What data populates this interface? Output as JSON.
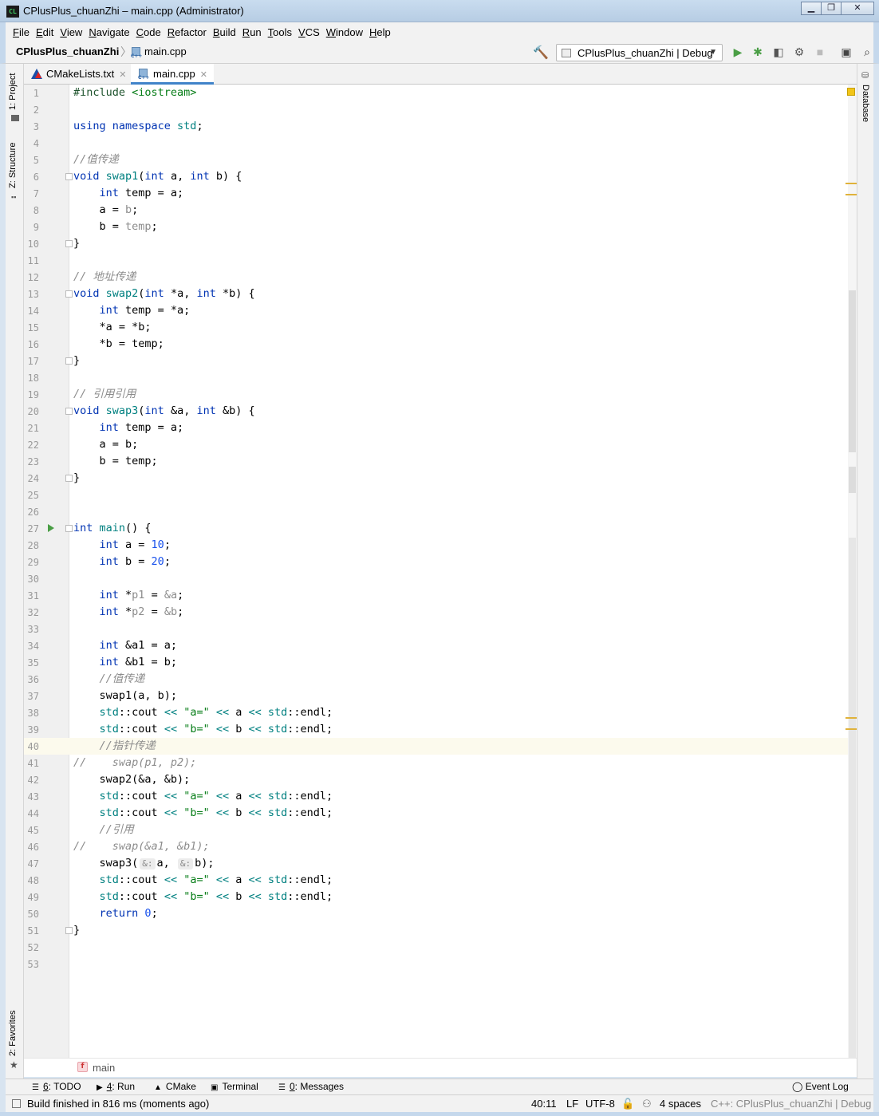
{
  "window": {
    "title": "CPlusPlus_chuanZhi – main.cpp (Administrator)",
    "app_icon_text": "CL",
    "buttons": [
      "▁",
      "❐",
      "✕"
    ]
  },
  "menu": [
    {
      "mnemonic": "F",
      "rest": "ile"
    },
    {
      "mnemonic": "E",
      "rest": "dit"
    },
    {
      "mnemonic": "V",
      "rest": "iew"
    },
    {
      "mnemonic": "N",
      "rest": "avigate"
    },
    {
      "mnemonic": "C",
      "rest": "ode"
    },
    {
      "mnemonic": "R",
      "rest": "efactor"
    },
    {
      "mnemonic": "B",
      "rest": "uild"
    },
    {
      "mnemonic": "R",
      "rest": "un"
    },
    {
      "mnemonic": "T",
      "rest": "ools"
    },
    {
      "mnemonic": "V",
      "rest": "CS"
    },
    {
      "mnemonic": "W",
      "rest": "indow"
    },
    {
      "mnemonic": "H",
      "rest": "elp"
    }
  ],
  "nav": {
    "project": "CPlusPlus_chuanZhi",
    "file": "main.cpp",
    "run_config": "CPlusPlus_chuanZhi | Debug"
  },
  "side_tabs": {
    "project": "1: Project",
    "structure": "Z: Structure",
    "favorites": "2: Favorites",
    "database": "Database"
  },
  "tabs": [
    {
      "label": "CMakeLists.txt",
      "active": false
    },
    {
      "label": "main.cpp",
      "active": true
    }
  ],
  "editor": {
    "current_line": 40,
    "lines": [
      [
        [
          "pp",
          "#include "
        ],
        [
          "inc",
          "<iostream>"
        ]
      ],
      [],
      [
        [
          "kw",
          "using namespace "
        ],
        [
          "ns",
          "std"
        ],
        [
          "",
          "; "
        ]
      ],
      [],
      [
        [
          "cm",
          "//值传递"
        ]
      ],
      [
        [
          "kw",
          "void "
        ],
        [
          "ns",
          "swap1"
        ],
        [
          "",
          "("
        ],
        [
          "kw",
          "int "
        ],
        [
          "",
          "a, "
        ],
        [
          "kw",
          "int "
        ],
        [
          "",
          "b) {"
        ]
      ],
      [
        [
          "",
          "    "
        ],
        [
          "kw",
          "int "
        ],
        [
          "",
          "temp = a;"
        ]
      ],
      [
        [
          "",
          "    a = "
        ],
        [
          "gray",
          "b"
        ],
        [
          "",
          ";"
        ]
      ],
      [
        [
          "",
          "    b = "
        ],
        [
          "gray",
          "temp"
        ],
        [
          "",
          ";"
        ]
      ],
      [
        [
          "",
          "}"
        ]
      ],
      [],
      [
        [
          "cm",
          "// 地址传递"
        ]
      ],
      [
        [
          "kw",
          "void "
        ],
        [
          "ns",
          "swap2"
        ],
        [
          "",
          "("
        ],
        [
          "kw",
          "int "
        ],
        [
          "",
          "*a, "
        ],
        [
          "kw",
          "int "
        ],
        [
          "",
          "*b) {"
        ]
      ],
      [
        [
          "",
          "    "
        ],
        [
          "kw",
          "int "
        ],
        [
          "",
          "temp = *a;"
        ]
      ],
      [
        [
          "",
          "    *a = *b;"
        ]
      ],
      [
        [
          "",
          "    *b = temp;"
        ]
      ],
      [
        [
          "",
          "}"
        ]
      ],
      [],
      [
        [
          "cm",
          "// 引用引用"
        ]
      ],
      [
        [
          "kw",
          "void "
        ],
        [
          "ns",
          "swap3"
        ],
        [
          "",
          "("
        ],
        [
          "kw",
          "int "
        ],
        [
          "",
          "&a, "
        ],
        [
          "kw",
          "int "
        ],
        [
          "",
          "&b) {"
        ]
      ],
      [
        [
          "",
          "    "
        ],
        [
          "kw",
          "int "
        ],
        [
          "",
          "temp = a;"
        ]
      ],
      [
        [
          "",
          "    a = b;"
        ]
      ],
      [
        [
          "",
          "    b = temp;"
        ]
      ],
      [
        [
          "",
          "}"
        ]
      ],
      [],
      [],
      [
        [
          "kw",
          "int "
        ],
        [
          "ns",
          "main"
        ],
        [
          "",
          "() {"
        ]
      ],
      [
        [
          "",
          "    "
        ],
        [
          "kw",
          "int "
        ],
        [
          "",
          "a = "
        ],
        [
          "num",
          "10"
        ],
        [
          "",
          ";"
        ]
      ],
      [
        [
          "",
          "    "
        ],
        [
          "kw",
          "int "
        ],
        [
          "",
          "b = "
        ],
        [
          "num",
          "20"
        ],
        [
          "",
          ";"
        ]
      ],
      [],
      [
        [
          "",
          "    "
        ],
        [
          "kw",
          "int "
        ],
        [
          "",
          "*"
        ],
        [
          "gray",
          "p1"
        ],
        [
          "",
          " = "
        ],
        [
          "gray",
          "&a"
        ],
        [
          "",
          ";"
        ]
      ],
      [
        [
          "",
          "    "
        ],
        [
          "kw",
          "int "
        ],
        [
          "",
          "*"
        ],
        [
          "gray",
          "p2"
        ],
        [
          "",
          " = "
        ],
        [
          "gray",
          "&b"
        ],
        [
          "",
          ";"
        ]
      ],
      [],
      [
        [
          "",
          "    "
        ],
        [
          "kw",
          "int "
        ],
        [
          "",
          "&a1 = a;"
        ]
      ],
      [
        [
          "",
          "    "
        ],
        [
          "kw",
          "int "
        ],
        [
          "",
          "&b1 = b;"
        ]
      ],
      [
        [
          "",
          "    "
        ],
        [
          "cm",
          "//值传递"
        ]
      ],
      [
        [
          "",
          "    swap1(a, b);"
        ]
      ],
      [
        [
          "",
          "    "
        ],
        [
          "ns",
          "std"
        ],
        [
          "",
          "::cout "
        ],
        [
          "ns",
          "<< "
        ],
        [
          "str",
          "\"a=\""
        ],
        [
          "ns",
          " << "
        ],
        [
          "",
          "a "
        ],
        [
          "ns",
          "<< "
        ],
        [
          "ns",
          "std"
        ],
        [
          "",
          "::endl;"
        ]
      ],
      [
        [
          "",
          "    "
        ],
        [
          "ns",
          "std"
        ],
        [
          "",
          "::cout "
        ],
        [
          "ns",
          "<< "
        ],
        [
          "str",
          "\"b=\""
        ],
        [
          "ns",
          " << "
        ],
        [
          "",
          "b "
        ],
        [
          "ns",
          "<< "
        ],
        [
          "ns",
          "std"
        ],
        [
          "",
          "::endl;"
        ]
      ],
      [
        [
          "",
          "    "
        ],
        [
          "cm",
          "//指针传递"
        ]
      ],
      [
        [
          "cm",
          "//    swap(p1, p2);"
        ]
      ],
      [
        [
          "",
          "    swap2(&a, &b);"
        ]
      ],
      [
        [
          "",
          "    "
        ],
        [
          "ns",
          "std"
        ],
        [
          "",
          "::cout "
        ],
        [
          "ns",
          "<< "
        ],
        [
          "str",
          "\"a=\""
        ],
        [
          "ns",
          " << "
        ],
        [
          "",
          "a "
        ],
        [
          "ns",
          "<< "
        ],
        [
          "ns",
          "std"
        ],
        [
          "",
          "::endl;"
        ]
      ],
      [
        [
          "",
          "    "
        ],
        [
          "ns",
          "std"
        ],
        [
          "",
          "::cout "
        ],
        [
          "ns",
          "<< "
        ],
        [
          "str",
          "\"b=\""
        ],
        [
          "ns",
          " << "
        ],
        [
          "",
          "b "
        ],
        [
          "ns",
          "<< "
        ],
        [
          "ns",
          "std"
        ],
        [
          "",
          "::endl;"
        ]
      ],
      [
        [
          "",
          "    "
        ],
        [
          "cm",
          "//引用"
        ]
      ],
      [
        [
          "cm",
          "//    swap(&a1, &b1);"
        ]
      ],
      [
        [
          "",
          "    swap3("
        ],
        [
          "hint",
          "&:"
        ],
        [
          "",
          "a, "
        ],
        [
          "hint",
          "&:"
        ],
        [
          "",
          "b);"
        ]
      ],
      [
        [
          "",
          "    "
        ],
        [
          "ns",
          "std"
        ],
        [
          "",
          "::cout "
        ],
        [
          "ns",
          "<< "
        ],
        [
          "str",
          "\"a=\""
        ],
        [
          "ns",
          " << "
        ],
        [
          "",
          "a "
        ],
        [
          "ns",
          "<< "
        ],
        [
          "ns",
          "std"
        ],
        [
          "",
          "::endl;"
        ]
      ],
      [
        [
          "",
          "    "
        ],
        [
          "ns",
          "std"
        ],
        [
          "",
          "::cout "
        ],
        [
          "ns",
          "<< "
        ],
        [
          "str",
          "\"b=\""
        ],
        [
          "ns",
          " << "
        ],
        [
          "",
          "b "
        ],
        [
          "ns",
          "<< "
        ],
        [
          "ns",
          "std"
        ],
        [
          "",
          "::endl;"
        ]
      ],
      [
        [
          "",
          "    "
        ],
        [
          "kw",
          "return "
        ],
        [
          "num",
          "0"
        ],
        [
          "",
          ";"
        ]
      ],
      [
        [
          "",
          "}"
        ]
      ],
      [],
      []
    ]
  },
  "breadcrumb_footer": {
    "badge": "f",
    "function": "main"
  },
  "tool_windows": [
    {
      "num": "6",
      "label": ": TODO",
      "icon": "☰"
    },
    {
      "num": "4",
      "label": ": Run",
      "icon": "▶"
    },
    {
      "num": "",
      "label": "CMake",
      "icon": "▲"
    },
    {
      "num": "",
      "label": "Terminal",
      "icon": "▣"
    },
    {
      "num": "0",
      "label": ": Messages",
      "icon": "☰"
    }
  ],
  "event_log": "Event Log",
  "status": {
    "message": "Build finished in 816 ms (moments ago)",
    "position": "40:11",
    "line_sep": "LF",
    "encoding": "UTF-8",
    "indent": "4 spaces",
    "context": "C++: CPlusPlus_chuanZhi | Debug"
  }
}
